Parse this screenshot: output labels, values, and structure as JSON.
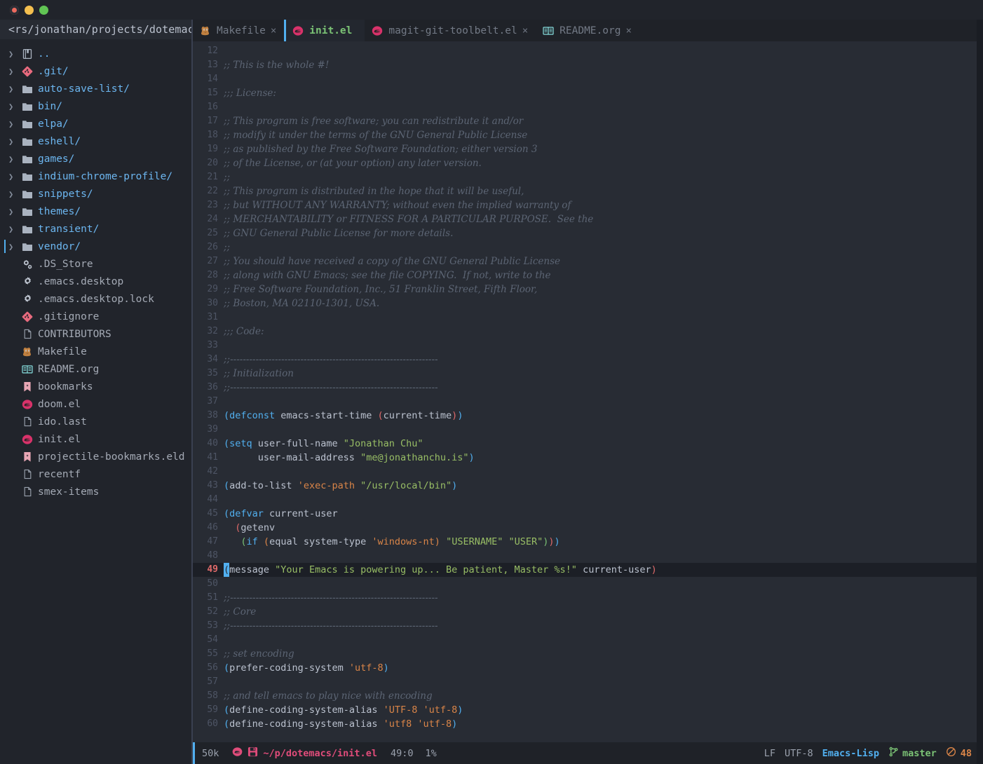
{
  "window": {
    "traffic_lights": [
      "close-button",
      "minimize-button",
      "maximize-button"
    ]
  },
  "sidebar": {
    "project_path": "<rs/jonathan/projects/dotemacs/",
    "items": [
      {
        "label": "..",
        "type": "dir",
        "icon": "book-icon",
        "expandable": true,
        "selected": false
      },
      {
        "label": ".git/",
        "type": "dir",
        "icon": "git-icon",
        "expandable": true,
        "selected": false
      },
      {
        "label": "auto-save-list/",
        "type": "dir",
        "icon": "folder-icon",
        "expandable": true,
        "selected": false
      },
      {
        "label": "bin/",
        "type": "dir",
        "icon": "folder-icon",
        "expandable": true,
        "selected": false
      },
      {
        "label": "elpa/",
        "type": "dir",
        "icon": "folder-icon",
        "expandable": true,
        "selected": false
      },
      {
        "label": "eshell/",
        "type": "dir",
        "icon": "folder-icon",
        "expandable": true,
        "selected": false
      },
      {
        "label": "games/",
        "type": "dir",
        "icon": "folder-icon",
        "expandable": true,
        "selected": false
      },
      {
        "label": "indium-chrome-profile/",
        "type": "dir",
        "icon": "folder-icon",
        "expandable": true,
        "selected": false
      },
      {
        "label": "snippets/",
        "type": "dir",
        "icon": "folder-icon",
        "expandable": true,
        "selected": false
      },
      {
        "label": "themes/",
        "type": "dir",
        "icon": "folder-icon",
        "expandable": true,
        "selected": false
      },
      {
        "label": "transient/",
        "type": "dir",
        "icon": "folder-icon",
        "expandable": true,
        "selected": false
      },
      {
        "label": "vendor/",
        "type": "dir",
        "icon": "folder-icon",
        "expandable": true,
        "selected": true
      },
      {
        "label": ".DS_Store",
        "type": "file",
        "icon": "cogs-icon",
        "expandable": false,
        "selected": false
      },
      {
        "label": ".emacs.desktop",
        "type": "file",
        "icon": "gear-icon",
        "expandable": false,
        "selected": false
      },
      {
        "label": ".emacs.desktop.lock",
        "type": "file",
        "icon": "gear-icon",
        "expandable": false,
        "selected": false
      },
      {
        "label": ".gitignore",
        "type": "file",
        "icon": "git-icon",
        "expandable": false,
        "selected": false
      },
      {
        "label": "CONTRIBUTORS",
        "type": "file",
        "icon": "document-icon",
        "expandable": false,
        "selected": false
      },
      {
        "label": "Makefile",
        "type": "file",
        "icon": "gnu-icon",
        "expandable": false,
        "selected": false
      },
      {
        "label": "README.org",
        "type": "file",
        "icon": "org-book-icon",
        "expandable": false,
        "selected": false
      },
      {
        "label": "bookmarks",
        "type": "file",
        "icon": "bookmark-icon",
        "expandable": false,
        "selected": false
      },
      {
        "label": "doom.el",
        "type": "file",
        "icon": "emacs-icon",
        "expandable": false,
        "selected": false
      },
      {
        "label": "ido.last",
        "type": "file",
        "icon": "document-icon",
        "expandable": false,
        "selected": false
      },
      {
        "label": "init.el",
        "type": "file",
        "icon": "emacs-icon",
        "expandable": false,
        "selected": false
      },
      {
        "label": "projectile-bookmarks.eld",
        "type": "file",
        "icon": "bookmark-icon",
        "expandable": false,
        "selected": false
      },
      {
        "label": "recentf",
        "type": "file",
        "icon": "document-icon",
        "expandable": false,
        "selected": false
      },
      {
        "label": "smex-items",
        "type": "file",
        "icon": "document-icon",
        "expandable": false,
        "selected": false
      }
    ]
  },
  "tabs": [
    {
      "label": "Makefile",
      "icon": "gnu-icon",
      "active": false,
      "closable": true
    },
    {
      "label": "init.el",
      "icon": "emacs-icon",
      "active": true,
      "closable": false
    },
    {
      "label": "magit-git-toolbelt.el",
      "icon": "emacs-icon",
      "active": false,
      "closable": true
    },
    {
      "label": "README.org",
      "icon": "org-book-icon",
      "active": false,
      "closable": true
    }
  ],
  "editor": {
    "current_line": 49,
    "first_line": 12,
    "lines": [
      {
        "n": 12,
        "segs": []
      },
      {
        "n": 13,
        "segs": [
          {
            "c": "cm",
            "t": ";; This is the whole #!"
          }
        ]
      },
      {
        "n": 14,
        "segs": []
      },
      {
        "n": 15,
        "segs": [
          {
            "c": "cm",
            "t": ";;; License:"
          }
        ]
      },
      {
        "n": 16,
        "segs": []
      },
      {
        "n": 17,
        "segs": [
          {
            "c": "cm",
            "t": ";; This program is free software; you can redistribute it and/or"
          }
        ]
      },
      {
        "n": 18,
        "segs": [
          {
            "c": "cm",
            "t": ";; modify it under the terms of the GNU General Public License"
          }
        ]
      },
      {
        "n": 19,
        "segs": [
          {
            "c": "cm",
            "t": ";; as published by the Free Software Foundation; either version 3"
          }
        ]
      },
      {
        "n": 20,
        "segs": [
          {
            "c": "cm",
            "t": ";; of the License, or (at your option) any later version."
          }
        ]
      },
      {
        "n": 21,
        "segs": [
          {
            "c": "cm",
            "t": ";;"
          }
        ]
      },
      {
        "n": 22,
        "segs": [
          {
            "c": "cm",
            "t": ";; This program is distributed in the hope that it will be useful,"
          }
        ]
      },
      {
        "n": 23,
        "segs": [
          {
            "c": "cm",
            "t": ";; but WITHOUT ANY WARRANTY; without even the implied warranty of"
          }
        ]
      },
      {
        "n": 24,
        "segs": [
          {
            "c": "cm",
            "t": ";; MERCHANTABILITY or FITNESS FOR A PARTICULAR PURPOSE.  See the"
          }
        ]
      },
      {
        "n": 25,
        "segs": [
          {
            "c": "cm",
            "t": ";; GNU General Public License for more details."
          }
        ]
      },
      {
        "n": 26,
        "segs": [
          {
            "c": "cm",
            "t": ";;"
          }
        ]
      },
      {
        "n": 27,
        "segs": [
          {
            "c": "cm",
            "t": ";; You should have received a copy of the GNU General Public License"
          }
        ]
      },
      {
        "n": 28,
        "segs": [
          {
            "c": "cm",
            "t": ";; along with GNU Emacs; see the file COPYING.  If not, write to the"
          }
        ]
      },
      {
        "n": 29,
        "segs": [
          {
            "c": "cm",
            "t": ";; Free Software Foundation, Inc., 51 Franklin Street, Fifth Floor,"
          }
        ]
      },
      {
        "n": 30,
        "segs": [
          {
            "c": "cm",
            "t": ";; Boston, MA 02110-1301, USA."
          }
        ]
      },
      {
        "n": 31,
        "segs": []
      },
      {
        "n": 32,
        "segs": [
          {
            "c": "cm",
            "t": ";;; Code:"
          }
        ]
      },
      {
        "n": 33,
        "segs": []
      },
      {
        "n": 34,
        "segs": [
          {
            "c": "cm",
            "t": ";;-----------------------------------------------------------------"
          }
        ]
      },
      {
        "n": 35,
        "segs": [
          {
            "c": "cm",
            "t": ";; Initialization"
          }
        ]
      },
      {
        "n": 36,
        "segs": [
          {
            "c": "cm",
            "t": ";;-----------------------------------------------------------------"
          }
        ]
      },
      {
        "n": 37,
        "segs": []
      },
      {
        "n": 38,
        "segs": [
          {
            "c": "p1",
            "t": "("
          },
          {
            "c": "kw",
            "t": "defconst"
          },
          {
            "c": "var",
            "t": " emacs-start-time "
          },
          {
            "c": "p2",
            "t": "("
          },
          {
            "c": "var",
            "t": "current-time"
          },
          {
            "c": "p2",
            "t": ")"
          },
          {
            "c": "p1",
            "t": ")"
          }
        ]
      },
      {
        "n": 39,
        "segs": []
      },
      {
        "n": 40,
        "segs": [
          {
            "c": "p1",
            "t": "("
          },
          {
            "c": "kw",
            "t": "setq"
          },
          {
            "c": "var",
            "t": " user-full-name "
          },
          {
            "c": "str",
            "t": "\"Jonathan Chu\""
          }
        ]
      },
      {
        "n": 41,
        "segs": [
          {
            "c": "var",
            "t": "      user-mail-address "
          },
          {
            "c": "str",
            "t": "\"me@jonathanchu.is\""
          },
          {
            "c": "p1",
            "t": ")"
          }
        ]
      },
      {
        "n": 42,
        "segs": []
      },
      {
        "n": 43,
        "segs": [
          {
            "c": "p1",
            "t": "("
          },
          {
            "c": "var",
            "t": "add-to-list "
          },
          {
            "c": "sym",
            "t": "'exec-path "
          },
          {
            "c": "str",
            "t": "\"/usr/local/bin\""
          },
          {
            "c": "p1",
            "t": ")"
          }
        ]
      },
      {
        "n": 44,
        "segs": []
      },
      {
        "n": 45,
        "segs": [
          {
            "c": "p1",
            "t": "("
          },
          {
            "c": "kw",
            "t": "defvar"
          },
          {
            "c": "var",
            "t": " current-user"
          }
        ]
      },
      {
        "n": 46,
        "segs": [
          {
            "c": "var",
            "t": "  "
          },
          {
            "c": "p2",
            "t": "("
          },
          {
            "c": "var",
            "t": "getenv"
          }
        ]
      },
      {
        "n": 47,
        "segs": [
          {
            "c": "var",
            "t": "   "
          },
          {
            "c": "p3",
            "t": "("
          },
          {
            "c": "kw",
            "t": "if "
          },
          {
            "c": "p4",
            "t": "("
          },
          {
            "c": "var",
            "t": "equal system-type "
          },
          {
            "c": "sym",
            "t": "'windows-nt"
          },
          {
            "c": "p4",
            "t": ")"
          },
          {
            "c": "var",
            "t": " "
          },
          {
            "c": "str",
            "t": "\"USERNAME\" \"USER\""
          },
          {
            "c": "p3",
            "t": ")"
          },
          {
            "c": "p2",
            "t": ")"
          },
          {
            "c": "p1",
            "t": ")"
          }
        ]
      },
      {
        "n": 48,
        "segs": []
      },
      {
        "n": 49,
        "segs": [
          {
            "c": "curs",
            "t": "("
          },
          {
            "c": "var",
            "t": "message "
          },
          {
            "c": "str",
            "t": "\"Your Emacs is powering up... Be patient, Master %s!\""
          },
          {
            "c": "var",
            "t": " current-user"
          },
          {
            "c": "p2",
            "t": ")"
          }
        ]
      },
      {
        "n": 50,
        "segs": []
      },
      {
        "n": 51,
        "segs": [
          {
            "c": "cm",
            "t": ";;-----------------------------------------------------------------"
          }
        ]
      },
      {
        "n": 52,
        "segs": [
          {
            "c": "cm",
            "t": ";; Core"
          }
        ]
      },
      {
        "n": 53,
        "segs": [
          {
            "c": "cm",
            "t": ";;-----------------------------------------------------------------"
          }
        ]
      },
      {
        "n": 54,
        "segs": []
      },
      {
        "n": 55,
        "segs": [
          {
            "c": "cm",
            "t": ";; set encoding"
          }
        ]
      },
      {
        "n": 56,
        "segs": [
          {
            "c": "p1",
            "t": "("
          },
          {
            "c": "var",
            "t": "prefer-coding-system "
          },
          {
            "c": "sym",
            "t": "'utf-8"
          },
          {
            "c": "p1",
            "t": ")"
          }
        ]
      },
      {
        "n": 57,
        "segs": []
      },
      {
        "n": 58,
        "segs": [
          {
            "c": "cm",
            "t": ";; and tell emacs to play nice with encoding"
          }
        ]
      },
      {
        "n": 59,
        "segs": [
          {
            "c": "p1",
            "t": "("
          },
          {
            "c": "var",
            "t": "define-coding-system-alias "
          },
          {
            "c": "sym",
            "t": "'UTF-8 "
          },
          {
            "c": "sym",
            "t": "'utf-8"
          },
          {
            "c": "p1",
            "t": ")"
          }
        ]
      },
      {
        "n": 60,
        "segs": [
          {
            "c": "p1",
            "t": "("
          },
          {
            "c": "var",
            "t": "define-coding-system-alias "
          },
          {
            "c": "sym",
            "t": "'utf8 "
          },
          {
            "c": "sym",
            "t": "'utf-8"
          },
          {
            "c": "p1",
            "t": ")"
          }
        ]
      }
    ]
  },
  "modeline": {
    "buffer_size": "50k",
    "file_path": "~/p/dotemacs/init.el",
    "position": "49:0",
    "percent": "1%",
    "line_ending": "LF",
    "encoding": "UTF-8",
    "major_mode": "Emacs-Lisp",
    "branch": "master",
    "error_count": "48",
    "accent_blue": "#51afef",
    "accent_pink": "#e04c7a",
    "accent_green": "#7bc275",
    "accent_orange": "#da8548"
  }
}
